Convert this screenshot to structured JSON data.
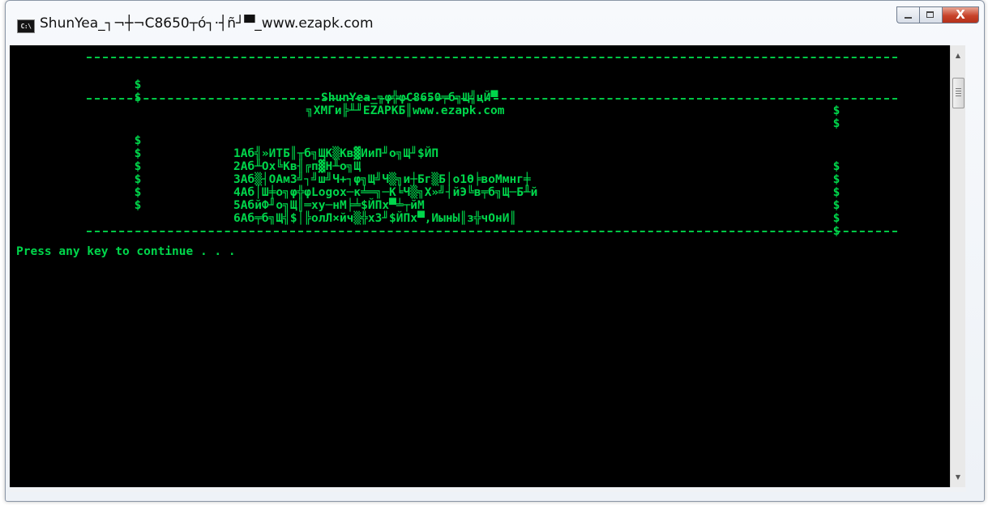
{
  "window": {
    "title": "ShunYea_┐¬┼¬C8650┬ó┐·┤ñ┘▀_www.ezapk.com",
    "icon": "cmd-console-icon",
    "icon_text": "C:\\",
    "buttons": {
      "minimize": "minimize",
      "maximize": "maximize",
      "close": "X"
    }
  },
  "console": {
    "border": "---------------------------------------------------------------------------------------",
    "header": {
      "line1": "ShunYea_╗φ╬φC8650╤б╗Щ╣цЙ▀",
      "line2": "╗ХМГи╠╨╜EZAPKБ║www.ezapk.com"
    },
    "menu": [
      "1Аб╣»ИТБ║╥б╗ЩК▒Кв▓ИиП╜о╗Щ╜$ЙП",
      "2Аб╨Ох╚Кв╢╔п▓Н╨о╗Щ",
      "3Аб▒┤ОАм3╝┐╝ш╝Ч+┐φ╗Щ╝Ч▒╗и┼Бг▒Б│о1Ө╞воМмнг╪",
      "4Аб│Ш╪о╗φ╬φLogoх─к╧═╗─К╘Ч▒╗Х»╝┤йЭ╚в╤б╗Щ─Б╨й",
      "5АбйФ╜о╗Щ║═ху─нМ╞╧$ЙПх▀╧┬йМ",
      "6Аб╤б╗Щ╣$│╠олЛ×йч▒╬х3╜$ЙПх▀,ИынЫ║з╬чОнИ║"
    ],
    "prompt": "Press any key to continue . . .",
    "text_color": "#00d64b",
    "background": "#000000"
  },
  "scrollbar": {
    "up": "▲",
    "down": "▼"
  }
}
